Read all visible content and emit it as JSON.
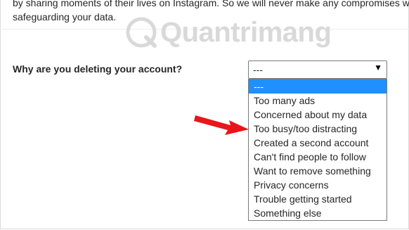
{
  "intro": {
    "line1": "by sharing moments of their lives on Instagram. So we will never make any compromises when",
    "line2": "safeguarding your data."
  },
  "watermark": {
    "text": "Quantrimang"
  },
  "form": {
    "question": "Why are you deleting your account?",
    "selected": "---",
    "options": [
      "---",
      "Too many ads",
      "Concerned about my data",
      "Too busy/too distracting",
      "Created a second account",
      "Can't find people to follow",
      "Want to remove something",
      "Privacy concerns",
      "Trouble getting started",
      "Something else"
    ]
  },
  "colors": {
    "highlight": "#1e90ff",
    "arrow": "#e8161b"
  },
  "icons": {
    "caret": "caret-down-icon",
    "arrow": "red-arrow-icon"
  }
}
